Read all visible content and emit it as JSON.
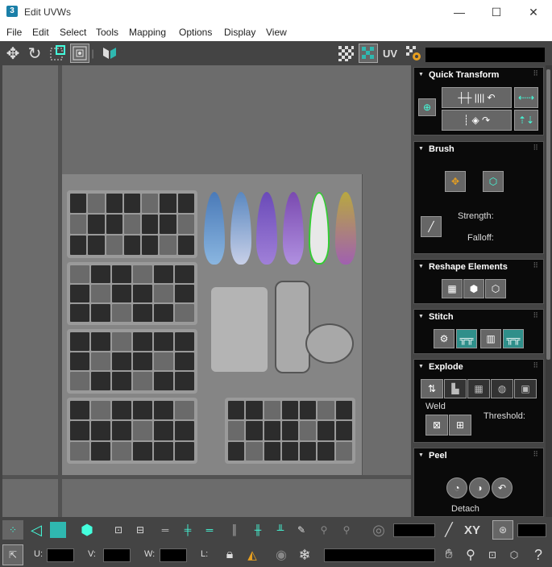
{
  "window": {
    "app_icon": "3",
    "title": "Edit UVWs",
    "minimize": "—",
    "maximize": "☐",
    "close": "✕"
  },
  "menu": [
    "File",
    "Edit",
    "Select",
    "Tools",
    "Mapping",
    "Options",
    "Display",
    "View"
  ],
  "toolbar": {
    "uv_label": "UV",
    "icons": [
      "move-icon",
      "rotate-icon",
      "scale-icon",
      "freeform-icon",
      "mirror-icon",
      "checker-icon",
      "texture-checker-icon",
      "settings-icon"
    ]
  },
  "rollouts": {
    "quick_transform": {
      "title": "Quick Transform"
    },
    "brush": {
      "title": "Brush",
      "strength_label": "Strength:",
      "falloff_label": "Falloff:"
    },
    "reshape": {
      "title": "Reshape Elements"
    },
    "stitch": {
      "title": "Stitch"
    },
    "explode": {
      "title": "Explode",
      "weld_label": "Weld",
      "threshold_label": "Threshold:"
    },
    "peel": {
      "title": "Peel",
      "detach_label": "Detach"
    }
  },
  "bottom": {
    "xy_label": "XY",
    "u_label": "U:",
    "v_label": "V:",
    "w_label": "W:",
    "l_label": "L:"
  },
  "colors": {
    "accent": "#2fb8b0",
    "panel_bg": "#0a0a0a",
    "viewport_bg": "#6c6c6c"
  }
}
